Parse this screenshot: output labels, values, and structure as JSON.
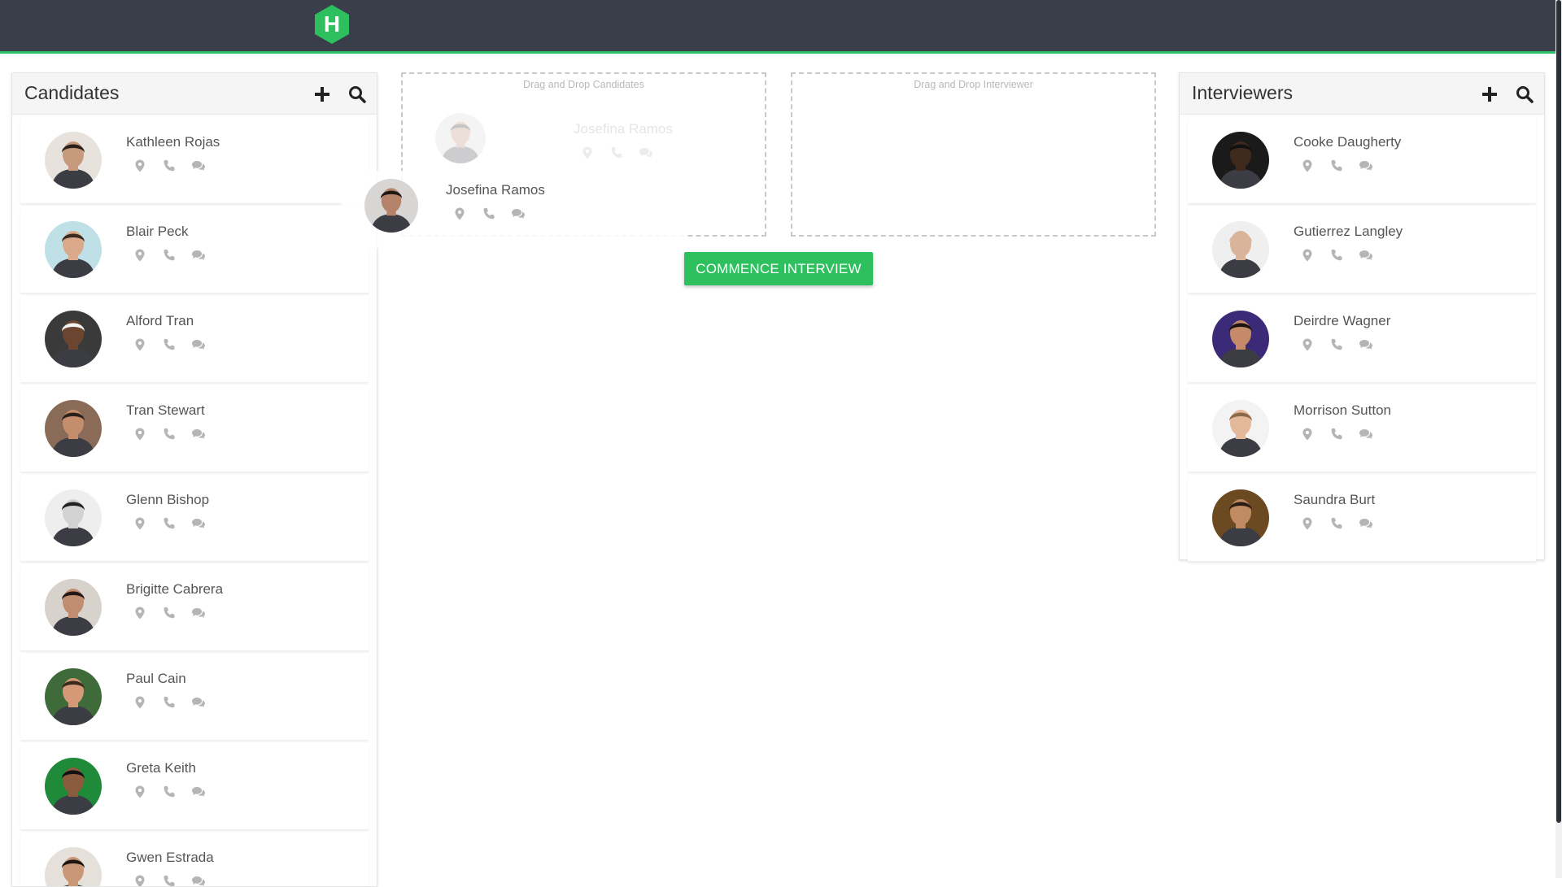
{
  "app": {
    "logo_letter": "H",
    "brand_color": "#2ebf5f",
    "topbar_color": "#393e4a"
  },
  "candidates": {
    "title": "Candidates",
    "items": [
      {
        "name": "Kathleen Rojas",
        "skin": "#c79a7e",
        "hair": "#2a211c",
        "bg": "#e8e2dc"
      },
      {
        "name": "Blair Peck",
        "skin": "#d9a98a",
        "hair": "#3b2a20",
        "bg": "#bfe0e6"
      },
      {
        "name": "Alford Tran",
        "skin": "#6b4530",
        "hair": "#f2f2f2",
        "bg": "#3a3a3a"
      },
      {
        "name": "Tran Stewart",
        "skin": "#c48e6c",
        "hair": "#2d2019",
        "bg": "#8a6b57"
      },
      {
        "name": "Glenn Bishop",
        "skin": "#d2d2d2",
        "hair": "#222222",
        "bg": "#eeeeee"
      },
      {
        "name": "Brigitte Cabrera",
        "skin": "#c08d70",
        "hair": "#231a16",
        "bg": "#d8d2cc"
      },
      {
        "name": "Paul Cain",
        "skin": "#d49a78",
        "hair": "#3a2a1c",
        "bg": "#3f6b3a"
      },
      {
        "name": "Greta Keith",
        "skin": "#8a5b3e",
        "hair": "#111111",
        "bg": "#1f8a3a"
      },
      {
        "name": "Gwen Estrada",
        "skin": "#c99775",
        "hair": "#1c1512",
        "bg": "#e6e0da"
      }
    ]
  },
  "interviewers": {
    "title": "Interviewers",
    "items": [
      {
        "name": "Cooke Daugherty",
        "skin": "#3f2a1e",
        "hair": "#111111",
        "bg": "#1a1a1a"
      },
      {
        "name": "Gutierrez Langley",
        "skin": "#d9b39a",
        "hair": "#d9b39a",
        "bg": "#efefef"
      },
      {
        "name": "Deirdre Wagner",
        "skin": "#c48a6a",
        "hair": "#1c1410",
        "bg": "#3b2a78"
      },
      {
        "name": "Morrison Sutton",
        "skin": "#e3b89b",
        "hair": "#8a6a4a",
        "bg": "#f3f3f3"
      },
      {
        "name": "Saundra Burt",
        "skin": "#c08a62",
        "hair": "#2a1e14",
        "bg": "#6b4a22"
      }
    ]
  },
  "dropzones": {
    "candidates_label": "Drag and Drop Candidates",
    "interviewer_label": "Drag and Drop Interviewer"
  },
  "dragging": {
    "name": "Josefina Ramos",
    "skin": "#b5836a",
    "hair": "#1e1815",
    "bg": "#d8d6d4"
  },
  "actions": {
    "commence_label": "COMMENCE INTERVIEW"
  },
  "icons": {
    "location": "location-pin-icon",
    "phone": "phone-icon",
    "chat": "chat-bubbles-icon",
    "add": "plus-icon",
    "search": "search-icon"
  }
}
